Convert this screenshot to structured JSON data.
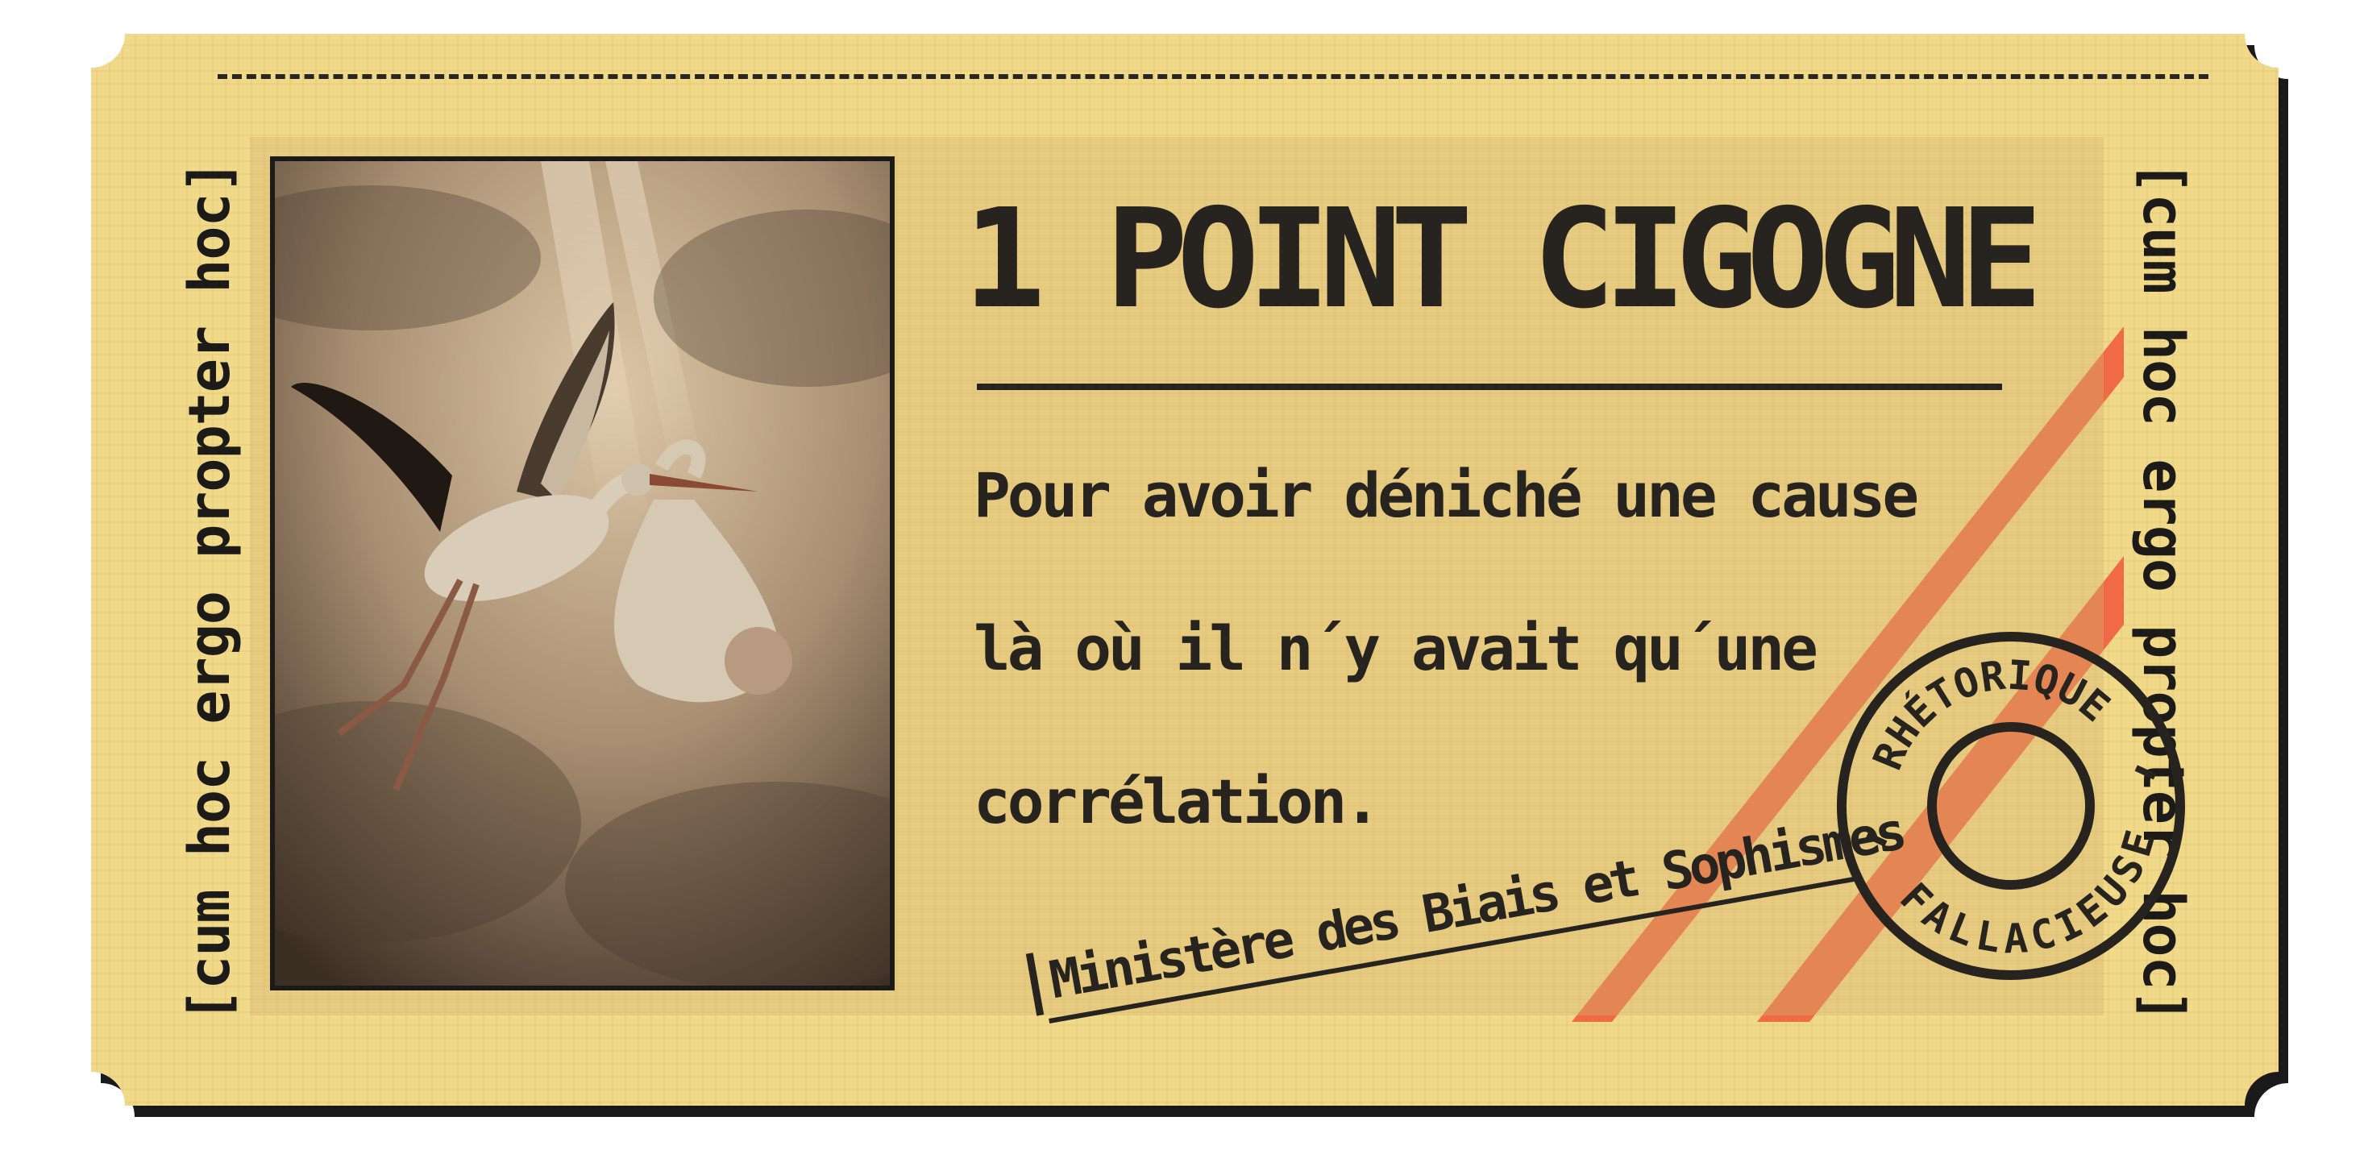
{
  "ticket": {
    "side_text_left": "[cum hoc ergo propter hoc]",
    "side_text_right": "[cum hoc ergo propter hoc]",
    "title": "1 POINT CIGOGNE",
    "body_lines": [
      "Pour avoir déniché une cause",
      "là où il n´y avait qu´une",
      "corrélation."
    ],
    "signature": "Ministère des Biais et Sophismes",
    "stamp_top": "RHÉTORIQUE",
    "stamp_bottom": "FALLACIEUSE",
    "photo_subject": "stork-carrying-baby-image"
  },
  "colors": {
    "ticket": "#f1d98a",
    "ink": "#27231f",
    "stripes": "#ef6a45",
    "shadow": "#1a1a1a",
    "photo_sepia": "#a98f72"
  }
}
